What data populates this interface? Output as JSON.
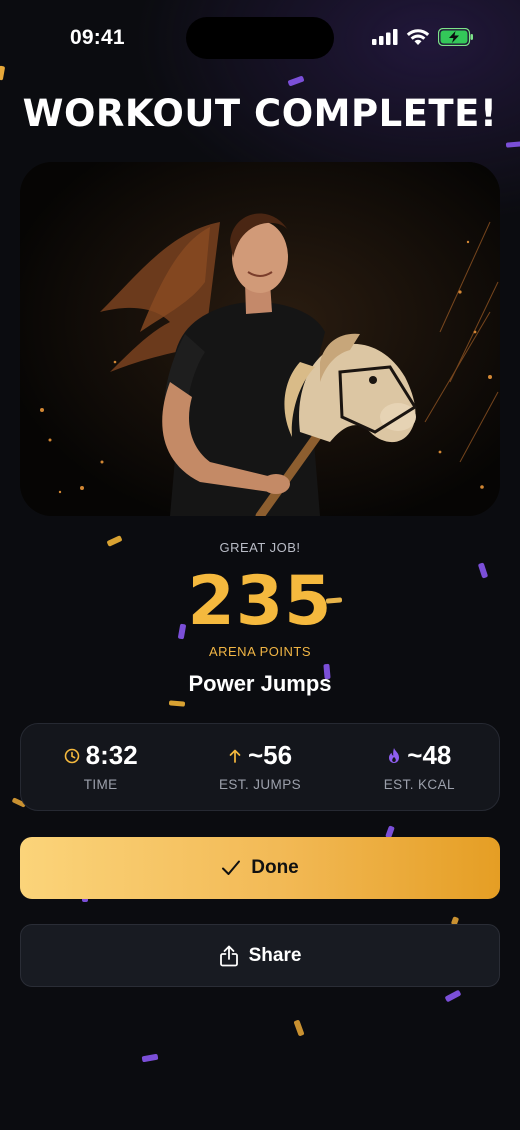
{
  "status_bar": {
    "time": "09:41"
  },
  "header": {
    "title": "WORKOUT COMPLETE!"
  },
  "hero": {
    "description_icon": "rider-on-hobby-horse-photo"
  },
  "result": {
    "kicker": "GREAT JOB!",
    "points": "235",
    "points_label": "ARENA POINTS",
    "workout_name": "Power Jumps"
  },
  "stats": [
    {
      "value": "8:32",
      "label": "TIME",
      "icon": "clock-icon"
    },
    {
      "value": "~56",
      "label": "EST. JUMPS",
      "icon": "arrow-up-icon"
    },
    {
      "value": "~48",
      "label": "EST. KCAL",
      "icon": "flame-icon"
    }
  ],
  "actions": {
    "done_label": "Done",
    "share_label": "Share"
  },
  "colors": {
    "accent_gold": "#f5b93e",
    "accent_purple": "#7b4fd8",
    "background": "#0b0c10",
    "card": "#14161c"
  }
}
